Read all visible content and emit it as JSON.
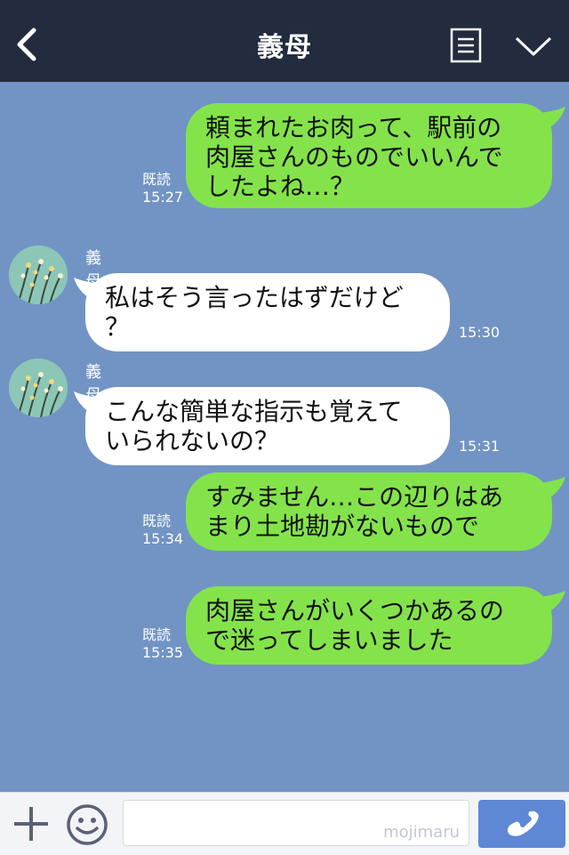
{
  "header": {
    "title": "義母"
  },
  "messages": [
    {
      "side": "right",
      "text": "頼まれたお肉って、駅前の\n肉屋さんのものでいいんで\nしたよね…？",
      "read": "既読",
      "time": "15:27"
    },
    {
      "side": "left",
      "sender": "義母",
      "text": "私はそう言ったはずだけど\n？",
      "time": "15:30"
    },
    {
      "side": "left",
      "sender": "義母",
      "text": "こんな簡単な指示も覚えて\nいられないの？",
      "time": "15:31"
    },
    {
      "side": "right",
      "text": "すみません…この辺りはあ\nまり土地勘がないもので",
      "read": "既読",
      "time": "15:34"
    },
    {
      "side": "right",
      "text": "肉屋さんがいくつかあるの\nで迷ってしまいました",
      "read": "既読",
      "time": "15:35"
    }
  ],
  "footer": {
    "watermark": "mojimaru"
  },
  "colors": {
    "header_bg": "#232b3e",
    "chat_bg": "#7194c4",
    "outgoing_bubble": "#84e34b",
    "incoming_bubble": "#ffffff",
    "call_button": "#5e87d6"
  },
  "icons": [
    "back-icon",
    "menu-icon",
    "collapse-icon",
    "plus-icon",
    "emoji-icon",
    "phone-icon"
  ]
}
